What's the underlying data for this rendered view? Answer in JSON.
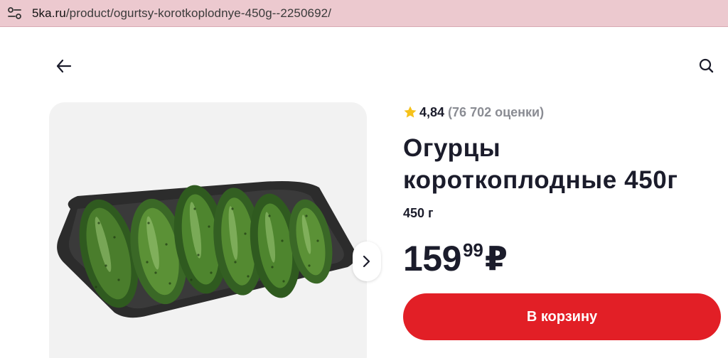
{
  "browser": {
    "url_host": "5ka.ru",
    "url_path": "/product/ogurtsy-korotkoplodnye-450g--2250692/",
    "site_info_icon": "tune-icon"
  },
  "header": {
    "back_icon": "arrow-left-icon",
    "search_icon": "search-icon"
  },
  "product": {
    "rating_score": "4,84",
    "rating_count": "(76 702 оценки)",
    "title": "Огурцы короткоплодные 450г",
    "weight": "450 г",
    "price_rub": "159",
    "price_kop": "99",
    "currency": "₽",
    "add_to_cart": "В корзину"
  },
  "gallery": {
    "next_icon": "chevron-right-icon",
    "image_subject": "cucumbers in tray"
  },
  "colors": {
    "accent_red": "#e21f26",
    "star_yellow": "#f6c21a",
    "address_bar": "#ecc9cf",
    "gallery_bg": "#f2f2f2"
  }
}
